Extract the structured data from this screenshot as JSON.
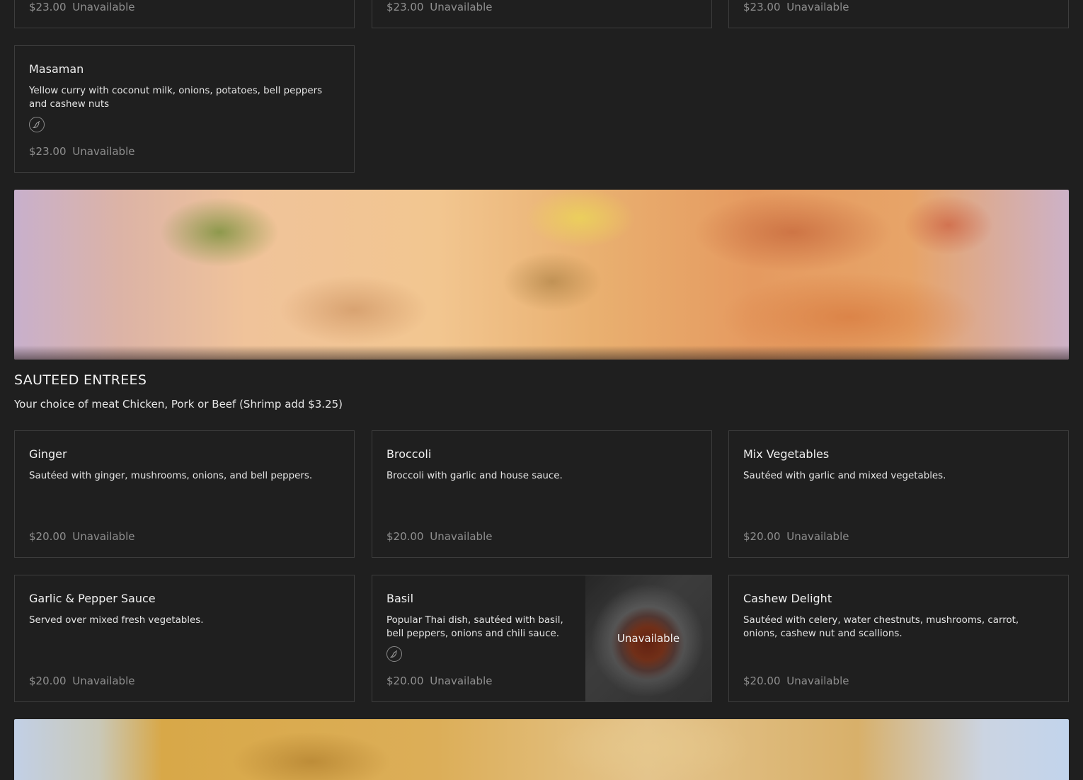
{
  "colors": {
    "background": "#1f1f1f",
    "card_border": "#3d3d3d",
    "muted_text": "#8f8f8f"
  },
  "top_cards": [
    {
      "price": "$23.00",
      "status": "Unavailable"
    },
    {
      "price": "$23.00",
      "status": "Unavailable"
    },
    {
      "price": "$23.00",
      "status": "Unavailable"
    }
  ],
  "masaman": {
    "name": "Masaman",
    "description": "Yellow curry with coconut milk, onions, potatoes, bell peppers and cashew nuts",
    "icon": "chili-pepper-icon",
    "price": "$23.00",
    "status": "Unavailable"
  },
  "section": {
    "title": "SAUTEED ENTREES",
    "subtitle": "Your choice of meat Chicken, Pork or Beef (Shrimp add $3.25)"
  },
  "items": [
    {
      "name": "Ginger",
      "description": "Sautéed with ginger, mushrooms, onions, and bell peppers.",
      "price": "$20.00",
      "status": "Unavailable"
    },
    {
      "name": "Broccoli",
      "description": "Broccoli with garlic and house sauce.",
      "price": "$20.00",
      "status": "Unavailable"
    },
    {
      "name": "Mix Vegetables",
      "description": "Sautéed with garlic and mixed vegetables.",
      "price": "$20.00",
      "status": "Unavailable"
    },
    {
      "name": "Garlic & Pepper Sauce",
      "description": "Served over mixed fresh vegetables.",
      "price": "$20.00",
      "status": "Unavailable"
    },
    {
      "name": "Basil",
      "description": "Popular Thai dish, sautéed with basil, bell peppers, onions and chili sauce.",
      "icon": "chili-pepper-icon",
      "price": "$20.00",
      "status": "Unavailable",
      "image_label": "Unavailable"
    },
    {
      "name": "Cashew Delight",
      "description": "Sautéed with celery, water chestnuts, mushrooms, carrot, onions, cashew nut and scallions.",
      "price": "$20.00",
      "status": "Unavailable"
    }
  ]
}
